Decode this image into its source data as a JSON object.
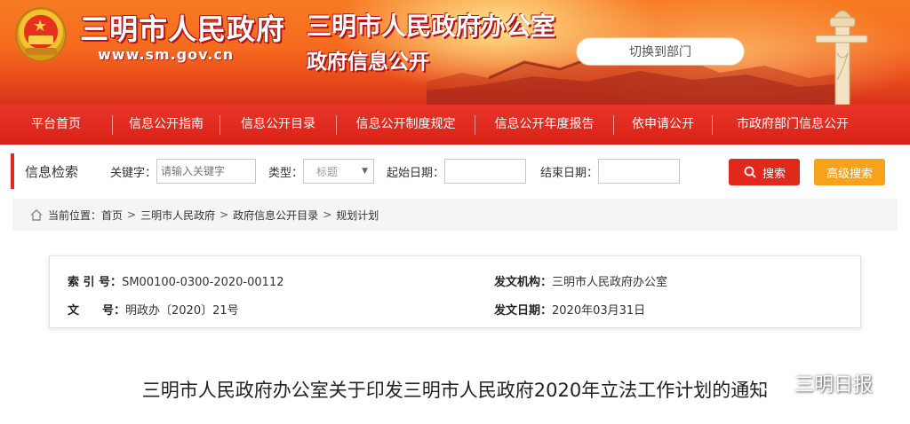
{
  "header": {
    "site_title": "三明市人民政府",
    "site_url": "www.sm.gov.cn",
    "office_title": "三明市人民政府办公室",
    "office_subtitle": "政府信息公开",
    "switch_button": "切换到部门"
  },
  "nav": {
    "items": [
      {
        "label": "平台首页"
      },
      {
        "label": "信息公开指南"
      },
      {
        "label": "信息公开目录"
      },
      {
        "label": "信息公开制度规定"
      },
      {
        "label": "信息公开年度报告"
      },
      {
        "label": "依申请公开"
      },
      {
        "label": "市政府部门信息公开"
      }
    ]
  },
  "search": {
    "title": "信息检索",
    "keyword_label": "关键字：",
    "keyword_placeholder": "请输入关键字",
    "type_label": "类型：",
    "type_selected": "标题",
    "start_label": "起始日期：",
    "end_label": "结束日期：",
    "search_button": "搜索",
    "advanced_button": "高级搜索"
  },
  "breadcrumb": {
    "prefix": "当前位置：",
    "items": [
      "首页",
      "三明市人民政府",
      "政府信息公开目录",
      "规划计划"
    ],
    "separator": ">"
  },
  "meta": {
    "index_label": "索 引 号：",
    "index_value": "SM00100-0300-2020-00112",
    "doc_no_label": "文　　号：",
    "doc_no_value": "明政办〔2020〕21号",
    "issuer_label": "发文机构：",
    "issuer_value": "三明市人民政府办公室",
    "date_label": "发文日期：",
    "date_value": "2020年03月31日"
  },
  "article": {
    "title": "三明市人民政府办公室关于印发三明市人民政府2020年立法工作计划的通知"
  },
  "watermark": {
    "text": "三明日报"
  },
  "colors": {
    "nav_red": "#d92216",
    "accent_red": "#e0281c",
    "accent_orange": "#f7a21b",
    "banner_orange": "#f56b1f"
  }
}
